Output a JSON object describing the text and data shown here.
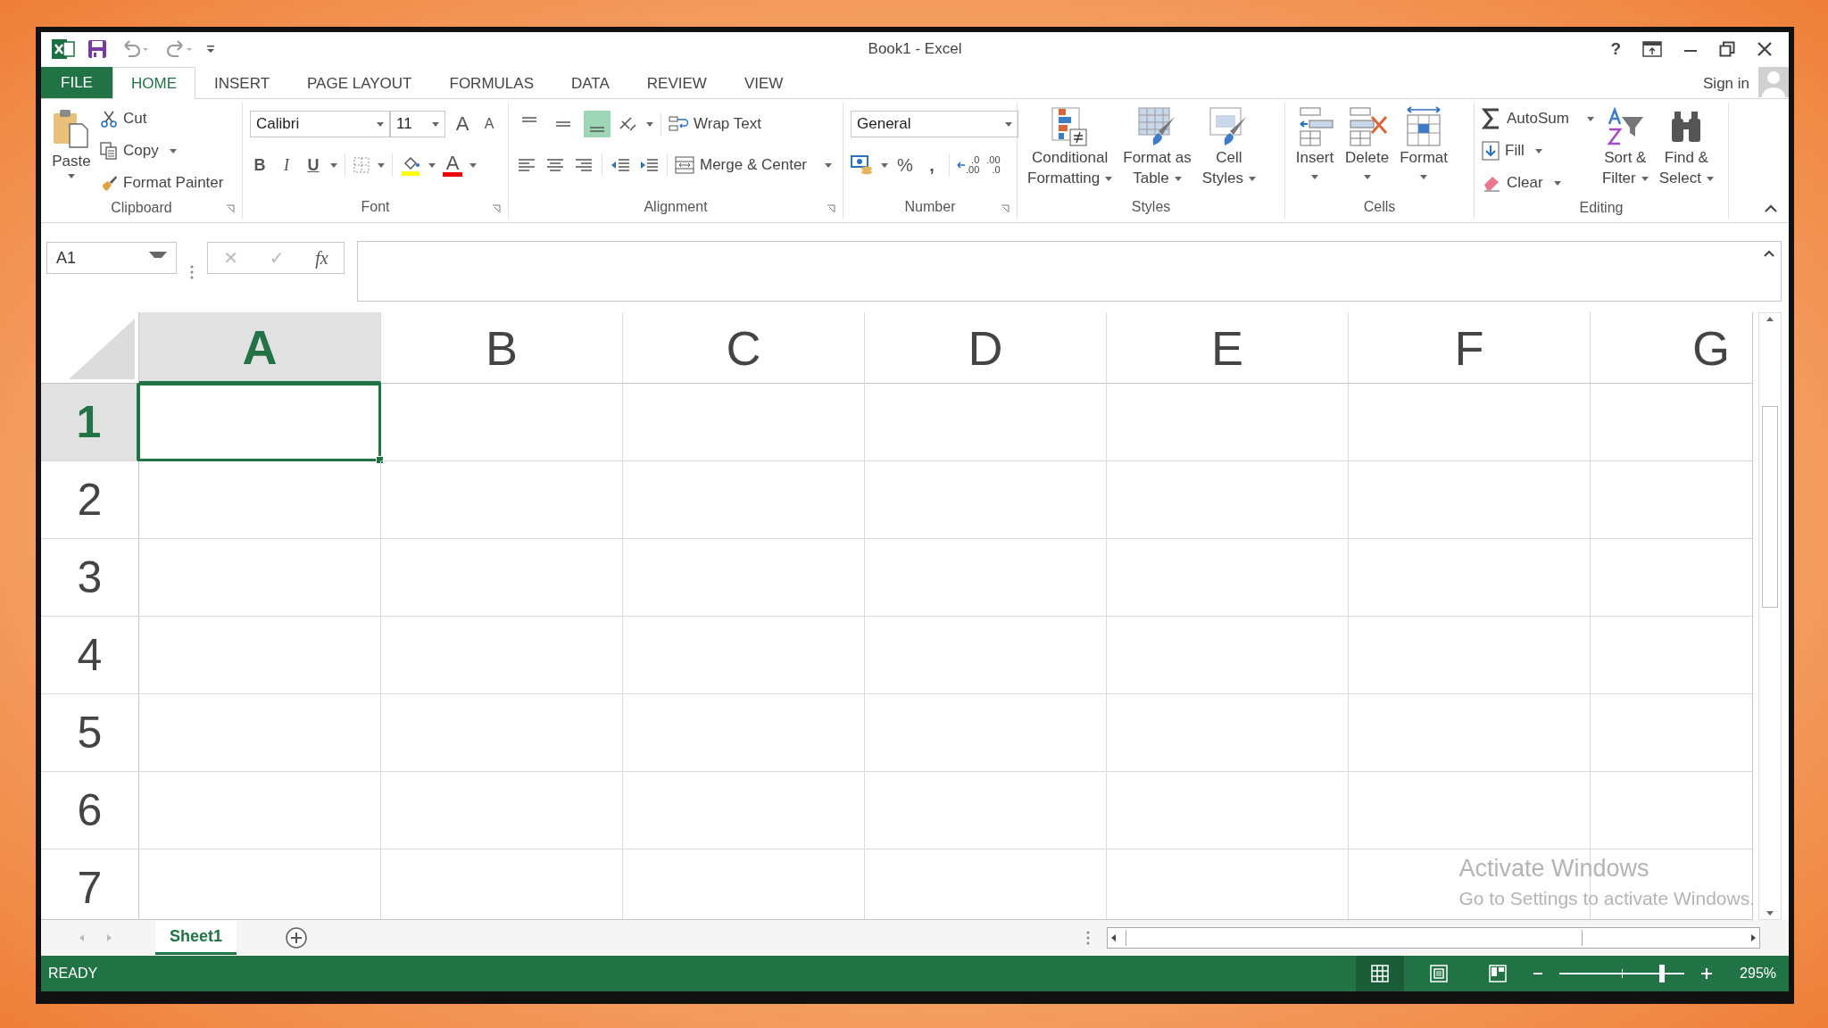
{
  "window": {
    "title": "Book1 - Excel",
    "help": "?"
  },
  "tabs": [
    {
      "label": "FILE",
      "kind": "file",
      "selected": false
    },
    {
      "label": "HOME",
      "kind": "tab",
      "selected": true
    },
    {
      "label": "INSERT",
      "kind": "tab",
      "selected": false
    },
    {
      "label": "PAGE LAYOUT",
      "kind": "tab",
      "selected": false
    },
    {
      "label": "FORMULAS",
      "kind": "tab",
      "selected": false
    },
    {
      "label": "DATA",
      "kind": "tab",
      "selected": false
    },
    {
      "label": "REVIEW",
      "kind": "tab",
      "selected": false
    },
    {
      "label": "VIEW",
      "kind": "tab",
      "selected": false
    }
  ],
  "account": {
    "label": "Sign in"
  },
  "clipboard": {
    "label": "Clipboard",
    "paste": "Paste",
    "cut": "Cut",
    "copy": "Copy",
    "format_painter": "Format Painter"
  },
  "font": {
    "label": "Font",
    "family": "Calibri",
    "size": "11",
    "grow": "A",
    "shrink": "A",
    "bold": "B",
    "italic": "I",
    "underline": "U",
    "color_glyph": "A"
  },
  "alignment": {
    "label": "Alignment",
    "vertical": [
      {
        "selected": false
      },
      {
        "selected": false
      },
      {
        "selected": true
      }
    ],
    "wrap_text": "Wrap Text",
    "merge_center": "Merge & Center"
  },
  "number": {
    "label": "Number",
    "format": "General",
    "percent": "%",
    "comma": ",",
    "increase_decimal": [
      ".0",
      ".00"
    ],
    "decrease_decimal": [
      ".00",
      ".0"
    ]
  },
  "styles": {
    "label": "Styles",
    "items": [
      {
        "lines": [
          "Conditional",
          "Formatting"
        ],
        "kind": "conditional"
      },
      {
        "lines": [
          "Format as",
          "Table"
        ],
        "kind": "table"
      },
      {
        "lines": [
          "Cell",
          "Styles"
        ],
        "kind": "cellstyles"
      }
    ]
  },
  "cells": {
    "label": "Cells",
    "items": [
      {
        "lines": [
          "Insert"
        ],
        "kind": "insert"
      },
      {
        "lines": [
          "Delete"
        ],
        "kind": "delete"
      },
      {
        "lines": [
          "Format"
        ],
        "kind": "format"
      }
    ]
  },
  "editing": {
    "label": "Editing",
    "autosum": "AutoSum",
    "fill": "Fill",
    "clear": "Clear",
    "sort": [
      "Sort &",
      "Filter"
    ],
    "find": [
      "Find &",
      "Select"
    ]
  },
  "formula_bar": {
    "name_box": "A1",
    "cancel": "✕",
    "enter": "✓",
    "function": "fx"
  },
  "sheet": {
    "columns": [
      {
        "label": "A",
        "selected": true
      },
      {
        "label": "B",
        "selected": false
      },
      {
        "label": "C",
        "selected": false
      },
      {
        "label": "D",
        "selected": false
      },
      {
        "label": "E",
        "selected": false
      },
      {
        "label": "F",
        "selected": false
      },
      {
        "label": "G",
        "selected": false
      }
    ],
    "rows": [
      {
        "label": "1",
        "selected": true
      },
      {
        "label": "2",
        "selected": false
      },
      {
        "label": "3",
        "selected": false
      },
      {
        "label": "4",
        "selected": false
      },
      {
        "label": "5",
        "selected": false
      },
      {
        "label": "6",
        "selected": false
      },
      {
        "label": "7",
        "selected": false
      }
    ]
  },
  "sheet_tabs": [
    {
      "label": "Sheet1",
      "selected": true
    }
  ],
  "activation_notice": {
    "title": "Activate Windows",
    "text": "Go to Settings to activate Windows."
  },
  "status_bar": {
    "text": "READY",
    "views": [
      {
        "kind": "normal",
        "selected": true
      },
      {
        "kind": "layout",
        "selected": false
      },
      {
        "kind": "pagebreak",
        "selected": false
      }
    ],
    "zoom": {
      "level": 0.82
    },
    "zoom_text": "295%"
  }
}
